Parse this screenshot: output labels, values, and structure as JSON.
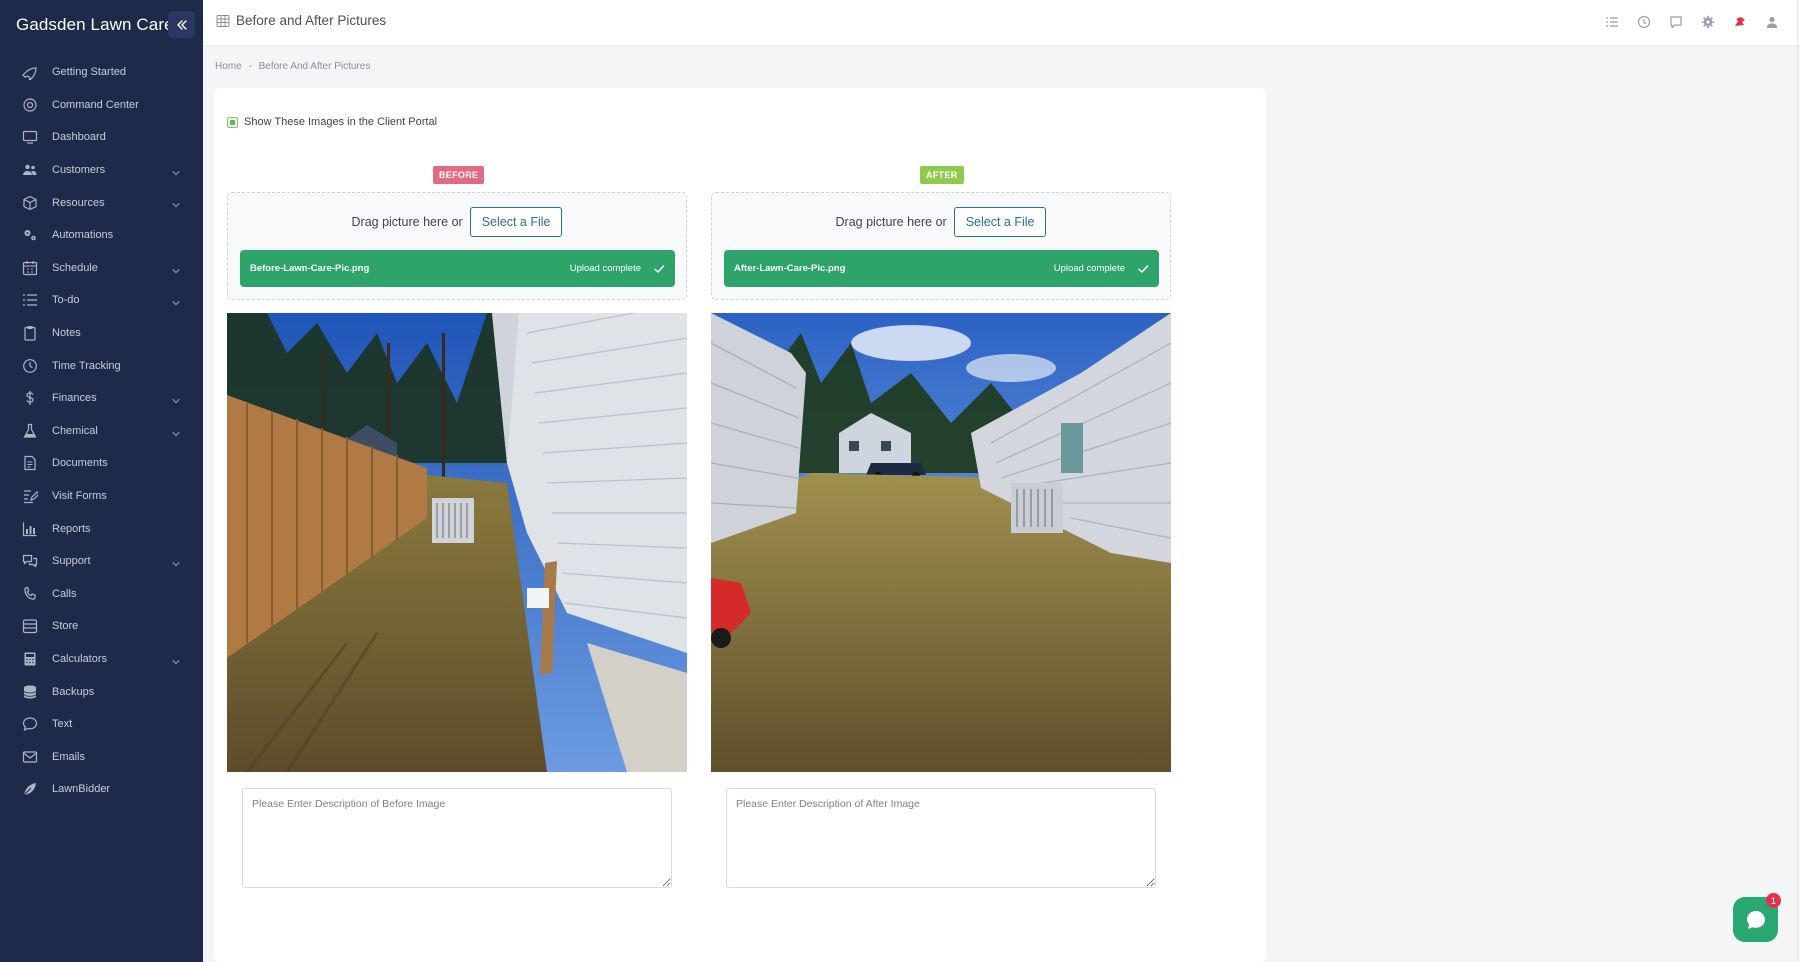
{
  "sidebar": {
    "brand": "Gadsden Lawn Care",
    "items": [
      {
        "label": "Getting Started",
        "icon": "rocket-icon",
        "has_submenu": false
      },
      {
        "label": "Command Center",
        "icon": "target-icon",
        "has_submenu": false
      },
      {
        "label": "Dashboard",
        "icon": "monitor-icon",
        "has_submenu": false
      },
      {
        "label": "Customers",
        "icon": "users-icon",
        "has_submenu": true
      },
      {
        "label": "Resources",
        "icon": "box-icon",
        "has_submenu": true
      },
      {
        "label": "Automations",
        "icon": "gears-icon",
        "has_submenu": false
      },
      {
        "label": "Schedule",
        "icon": "calendar-icon",
        "has_submenu": true
      },
      {
        "label": "To-do",
        "icon": "list-icon",
        "has_submenu": true
      },
      {
        "label": "Notes",
        "icon": "clipboard-icon",
        "has_submenu": false
      },
      {
        "label": "Time Tracking",
        "icon": "clock-icon",
        "has_submenu": false
      },
      {
        "label": "Finances",
        "icon": "dollar-icon",
        "has_submenu": true
      },
      {
        "label": "Chemical",
        "icon": "flask-icon",
        "has_submenu": true
      },
      {
        "label": "Documents",
        "icon": "document-icon",
        "has_submenu": false
      },
      {
        "label": "Visit Forms",
        "icon": "form-edit-icon",
        "has_submenu": false
      },
      {
        "label": "Reports",
        "icon": "bar-chart-icon",
        "has_submenu": false
      },
      {
        "label": "Support",
        "icon": "support-chat-icon",
        "has_submenu": true
      },
      {
        "label": "Calls",
        "icon": "phone-icon",
        "has_submenu": false
      },
      {
        "label": "Store",
        "icon": "store-icon",
        "has_submenu": false
      },
      {
        "label": "Calculators",
        "icon": "calculator-icon",
        "has_submenu": true
      },
      {
        "label": "Backups",
        "icon": "database-icon",
        "has_submenu": false
      },
      {
        "label": "Text",
        "icon": "message-icon",
        "has_submenu": false
      },
      {
        "label": "Emails",
        "icon": "envelope-icon",
        "has_submenu": false
      },
      {
        "label": "LawnBidder",
        "icon": "leaf-icon",
        "has_submenu": false
      }
    ]
  },
  "header": {
    "title": "Before and After Pictures",
    "icons": [
      "list-icon",
      "history-icon",
      "chat-icon",
      "gear-icon",
      "notification-icon",
      "user-icon"
    ]
  },
  "breadcrumb": {
    "home": "Home",
    "separator": "-",
    "current": "Before And After Pictures"
  },
  "portal": {
    "label": "Show These Images in the Client Portal",
    "checked": true
  },
  "before": {
    "badge": "BEFORE",
    "drag_text": "Drag picture here or",
    "select_label": "Select a File",
    "file_name": "Before-Lawn-Care-Pic.png",
    "upload_status": "Upload complete",
    "description_placeholder": "Please Enter Description of Before Image",
    "description_value": ""
  },
  "after": {
    "badge": "AFTER",
    "drag_text": "Drag picture here or",
    "select_label": "Select a File",
    "file_name": "After-Lawn-Care-Pic.png",
    "upload_status": "Upload complete",
    "description_placeholder": "Please Enter Description of After Image",
    "description_value": ""
  },
  "chat": {
    "unread": "1"
  },
  "colors": {
    "sidebar_bg": "#1e2a4a",
    "before_badge": "#e26a83",
    "after_badge": "#8fc94e",
    "upload_bar": "#2ea36a",
    "chat_button": "#2aa872"
  }
}
